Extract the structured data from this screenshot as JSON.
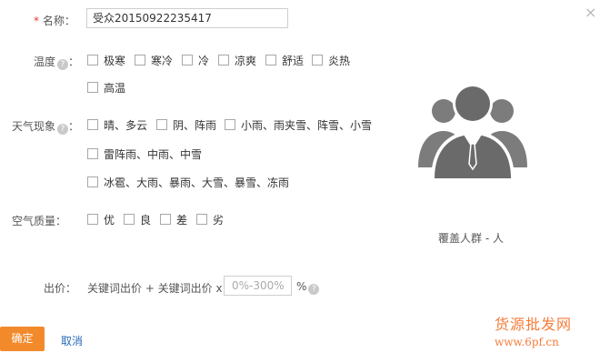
{
  "form": {
    "required_mark": "*",
    "name_label": "名称：",
    "name_value": "受众20150922235417",
    "temperature_label": "温度",
    "weather_label": "天气现象",
    "air_label": "空气质量",
    "bid_label": "出价：",
    "help_glyph": "?",
    "colon": "："
  },
  "temperature_options": [
    "极寒",
    "寒冷",
    "冷",
    "凉爽",
    "舒适",
    "炎热",
    "高温"
  ],
  "weather_options": [
    "晴、多云",
    "阴、阵雨",
    "小雨、雨夹雪、阵雪、小雪",
    "雷阵雨、中雨、中雪",
    "冰雹、大雨、暴雨、大雪、暴雪、冻雨"
  ],
  "air_options": [
    "优",
    "良",
    "差",
    "劣"
  ],
  "bid": {
    "formula": "关键词出价 + 关键词出价 x",
    "placeholder": "0%-300%",
    "unit": "%"
  },
  "coverage": {
    "text": "覆盖人群 - 人"
  },
  "buttons": {
    "confirm": "确定",
    "cancel": "取消"
  },
  "close_glyph": "×",
  "watermark": {
    "line1": "货源批发网",
    "line2": "www.6pf.cn"
  },
  "icons": {
    "people": "people-group-icon",
    "close": "close-icon",
    "help": "help-icon"
  },
  "colors": {
    "confirm_button": "#f28a2c",
    "link": "#2a6ab8",
    "required": "#e4393c"
  }
}
